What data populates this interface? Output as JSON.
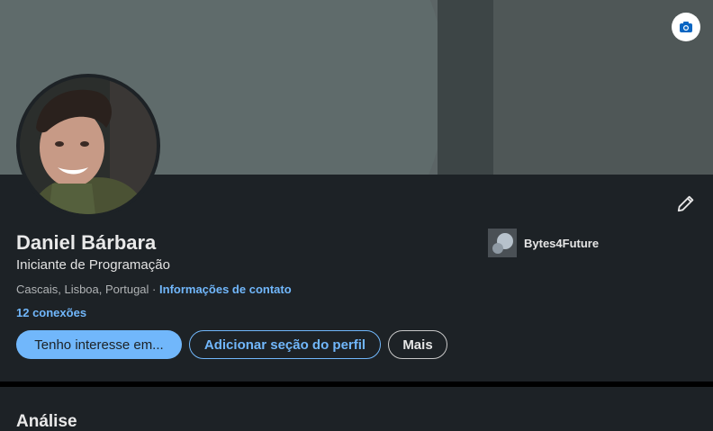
{
  "profile": {
    "name": "Daniel Bárbara",
    "headline": "Iniciante de Programação",
    "location": "Cascais, Lisboa, Portugal",
    "separator": "·",
    "contact_link": "Informações de contato",
    "connections": "12 conexões"
  },
  "company": {
    "name": "Bytes4Future"
  },
  "actions": {
    "open_to": "Tenho interesse em...",
    "add_section": "Adicionar seção do perfil",
    "more": "Mais"
  },
  "analytics": {
    "title": "Análise"
  },
  "icons": {
    "banner": "camera-icon",
    "edit": "pencil-icon"
  },
  "colors": {
    "background": "#1d2226",
    "accent": "#71b7fb",
    "banner": "#5c6566"
  }
}
